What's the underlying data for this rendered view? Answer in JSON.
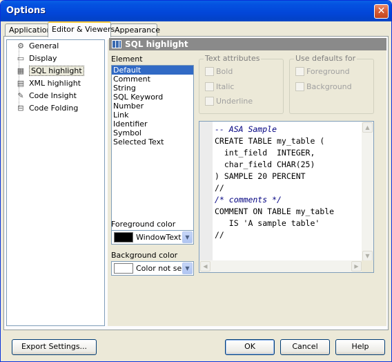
{
  "window": {
    "title": "Options",
    "close_icon": "close-icon"
  },
  "tabs": [
    {
      "label": "Application",
      "active": false
    },
    {
      "label": "Editor & Viewers",
      "active": true
    },
    {
      "label": "Appearance",
      "active": false
    }
  ],
  "tree": {
    "items": [
      {
        "label": "General",
        "icon": "general-settings-icon"
      },
      {
        "label": "Display",
        "icon": "display-icon"
      },
      {
        "label": "SQL highlight",
        "icon": "grid-icon",
        "selected": true
      },
      {
        "label": "XML highlight",
        "icon": "xml-icon"
      },
      {
        "label": "Code Insight",
        "icon": "code-insight-icon"
      },
      {
        "label": "Code Folding",
        "icon": "code-folding-icon"
      }
    ]
  },
  "section": {
    "title": "SQL highlight"
  },
  "element": {
    "label": "Element",
    "items": [
      "Default",
      "Comment",
      "String",
      "SQL Keyword",
      "Number",
      "Link",
      "Identifier",
      "Symbol",
      "Selected Text"
    ],
    "selected": "Default"
  },
  "text_attributes": {
    "title": "Text attributes",
    "bold": "Bold",
    "italic": "Italic",
    "underline": "Underline"
  },
  "use_defaults": {
    "title": "Use defaults for",
    "foreground": "Foreground",
    "background": "Background"
  },
  "foreground_color": {
    "label": "Foreground color",
    "value": "WindowText",
    "swatch": "#000000"
  },
  "background_color": {
    "label": "Background color",
    "value": "Color not sele",
    "swatch": "#ffffff"
  },
  "preview": {
    "lines": [
      "-- ASA Sample",
      "CREATE TABLE my_table (",
      "  int_field  INTEGER,",
      "  char_field CHAR(25)",
      ") SAMPLE 20 PERCENT",
      "//",
      "",
      "/* comments */",
      "COMMENT ON TABLE my_table",
      "   IS 'A sample table'",
      "//"
    ]
  },
  "buttons": {
    "export": "Export Settings...",
    "ok": "OK",
    "cancel": "Cancel",
    "help": "Help"
  },
  "colors": {
    "titlebar": "#0246d8",
    "selection": "#316ac5",
    "section_header": "#8a8a8a"
  }
}
